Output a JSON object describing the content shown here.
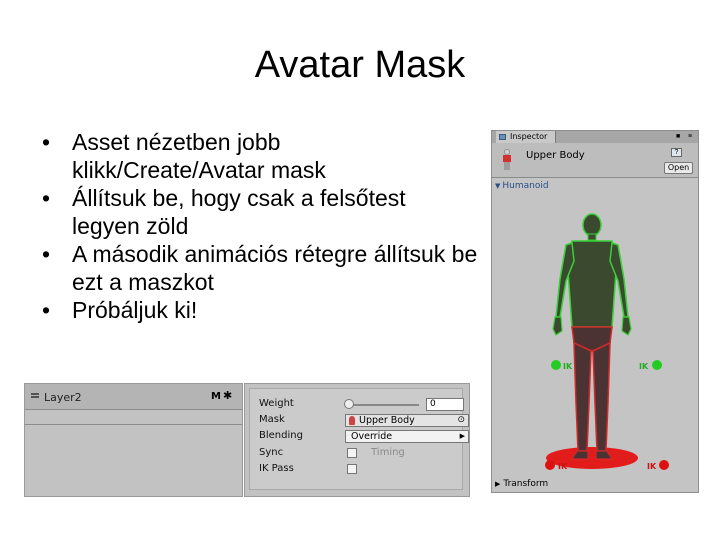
{
  "slide": {
    "title": "Avatar Mask",
    "bullets": [
      "Asset nézetben jobb klikk/Create/Avatar mask",
      "Állítsuk be, hogy csak a felsőtest legyen zöld",
      "A második animációs rétegre állítsuk be ezt a maszkot",
      "Próbáljuk ki!"
    ]
  },
  "layer_panel": {
    "layer_name": "Layer2",
    "flag": "M",
    "settings": {
      "weight_label": "Weight",
      "weight_value": "0",
      "weight_slider_fraction": 0.0,
      "mask_label": "Mask",
      "mask_value": "Upper Body",
      "blending_label": "Blending",
      "blending_value": "Override",
      "sync_label": "Sync",
      "sync_checked": false,
      "timing_label": "Timing",
      "ikpass_label": "IK Pass",
      "ikpass_checked": false
    }
  },
  "inspector": {
    "tab_label": "Inspector",
    "asset_name": "Upper Body",
    "open_button": "Open",
    "section_label": "Humanoid",
    "ik_label": "IK",
    "transform_label": "Transform",
    "colors": {
      "enabled": "#3fbf3f",
      "disabled": "#cc2222",
      "ik_dot_on": "#22cc22",
      "ik_dot_off": "#dd1111"
    }
  }
}
